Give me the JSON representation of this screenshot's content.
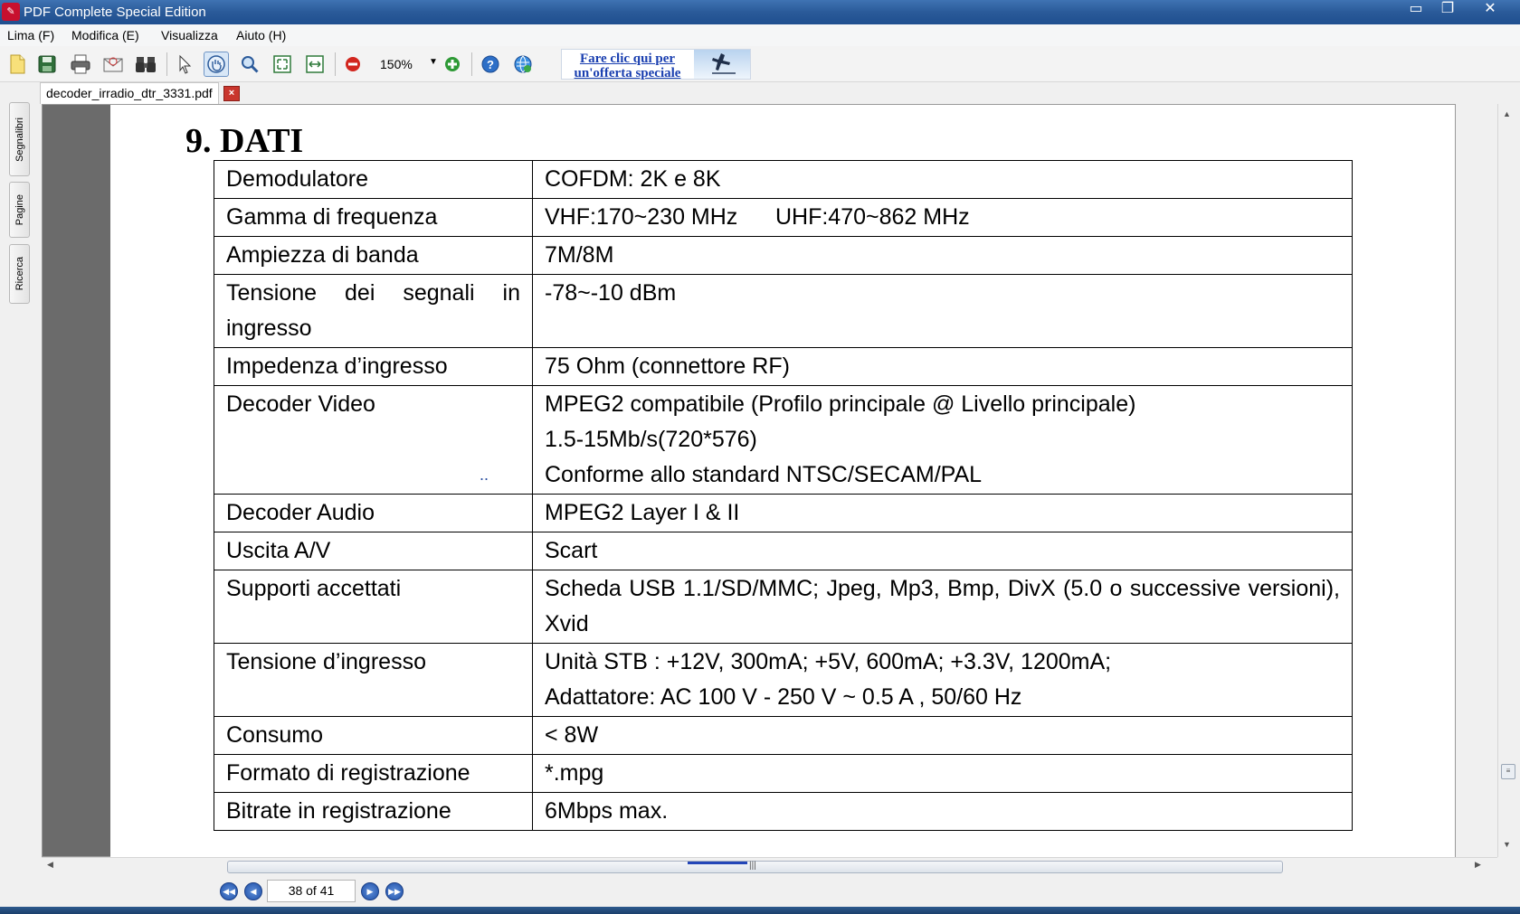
{
  "window": {
    "title": "PDF Complete Special Edition",
    "minimize": "▭",
    "restore": "❐",
    "close": "✕"
  },
  "menu": {
    "items": [
      "Lima (F)",
      "Modifica (E)",
      "Visualizza",
      "Aiuto (H)"
    ]
  },
  "toolbar": {
    "zoom": "150%",
    "zoom_dropdown": "▼",
    "promo_line1": "Fare clic qui per",
    "promo_line2": "un'offerta speciale"
  },
  "tab": {
    "filename": "decoder_irradio_dtr_3331.pdf",
    "close": "×"
  },
  "side_panels": [
    "Segnalibri",
    "Pagine",
    "Ricerca"
  ],
  "document": {
    "heading": "9. DATI",
    "ellipsis": "..",
    "rows": [
      {
        "label": "Demodulatore",
        "value": [
          "COFDM: 2K e 8K"
        ]
      },
      {
        "label": "Gamma di frequenza",
        "value": [
          "VHF:170~230 MHz      UHF:470~862 MHz"
        ]
      },
      {
        "label": "Ampiezza di banda",
        "value": [
          "7M/8M"
        ]
      },
      {
        "label": "Tensione dei segnali in ingresso",
        "value": [
          "-78~-10 dBm"
        ]
      },
      {
        "label": "Impedenza d’ingresso",
        "value": [
          "75 Ohm (connettore RF)"
        ]
      },
      {
        "label": "Decoder Video",
        "value": [
          "MPEG2 compatibile (Profilo principale @ Livello principale)",
          "1.5-15Mb/s(720*576)",
          "Conforme allo standard NTSC/SECAM/PAL"
        ]
      },
      {
        "label": "Decoder Audio",
        "value": [
          "MPEG2 Layer I & II"
        ]
      },
      {
        "label": "Uscita A/V",
        "value": [
          "Scart"
        ]
      },
      {
        "label": "Supporti accettati",
        "value": [
          "Scheda USB 1.1/SD/MMC; Jpeg, Mp3, Bmp, DivX (5.0 o successive versioni), Xvid"
        ]
      },
      {
        "label": "Tensione d’ingresso",
        "value": [
          "Unità STB : +12V, 300mA; +5V, 600mA; +3.3V, 1200mA;",
          "Adattatore: AC 100 V - 250 V ~ 0.5 A , 50/60 Hz"
        ]
      },
      {
        "label": "Consumo",
        "value": [
          "< 8W"
        ]
      },
      {
        "label": "Formato di registrazione",
        "value": [
          "*.mpg"
        ]
      },
      {
        "label": "Bitrate in registrazione",
        "value": [
          "6Mbps max."
        ]
      }
    ]
  },
  "pagination": {
    "current": "38 of 41",
    "first": "◀◀",
    "prev": "◀",
    "next": "▶",
    "last": "▶▶"
  },
  "scroll": {
    "up": "▲",
    "down": "▼",
    "left": "◀",
    "right": "▶",
    "grip": "≡",
    "hgrip": "|||"
  }
}
